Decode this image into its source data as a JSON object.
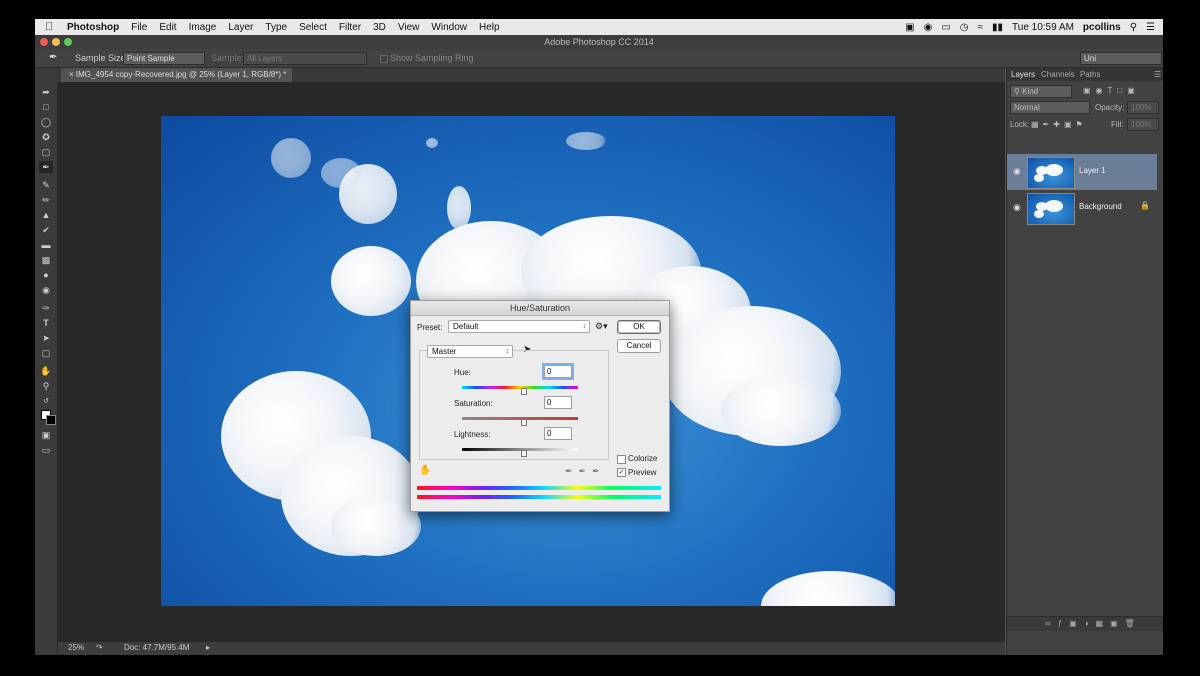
{
  "menubar": {
    "app": "Photoshop",
    "items": [
      "File",
      "Edit",
      "Image",
      "Layer",
      "Type",
      "Select",
      "Filter",
      "3D",
      "View",
      "Window",
      "Help"
    ],
    "clock": "Tue 10:59 AM",
    "user": "pcollins"
  },
  "window": {
    "title": "Adobe Photoshop CC 2014"
  },
  "options": {
    "sample_size_label": "Sample Size:",
    "sample_size_value": "Point Sample",
    "sample_label": "Sample:",
    "sample_value": "All Layers",
    "show_ring": "Show Sampling Ring",
    "workspace": "Uni"
  },
  "document": {
    "tab": "IMG_4954 copy-Recovered.jpg @ 25% (Layer 1, RGB/8*) *"
  },
  "status": {
    "zoom": "25%",
    "doc": "Doc: 47.7M/95.4M"
  },
  "panel": {
    "tabs": [
      "Layers",
      "Channels",
      "Paths"
    ],
    "kind": "Kind",
    "blend": "Normal",
    "opacity_label": "Opacity:",
    "opacity_value": "100%",
    "lock_label": "Lock:",
    "fill_label": "Fill:",
    "fill_value": "100%",
    "layers": [
      {
        "name": "Layer 1",
        "selected": true
      },
      {
        "name": "Background",
        "selected": false
      }
    ]
  },
  "dialog": {
    "title": "Hue/Saturation",
    "preset_label": "Preset:",
    "preset_value": "Default",
    "channel": "Master",
    "ok": "OK",
    "cancel": "Cancel",
    "hue_label": "Hue:",
    "hue_value": "0",
    "saturation_label": "Saturation:",
    "saturation_value": "0",
    "lightness_label": "Lightness:",
    "lightness_value": "0",
    "colorize": "Colorize",
    "preview": "Preview",
    "preview_checked": true,
    "colorize_checked": false
  },
  "colors": {
    "accent": "#7fb1e8",
    "sky": "#1f6fc0",
    "panel": "#424242"
  }
}
